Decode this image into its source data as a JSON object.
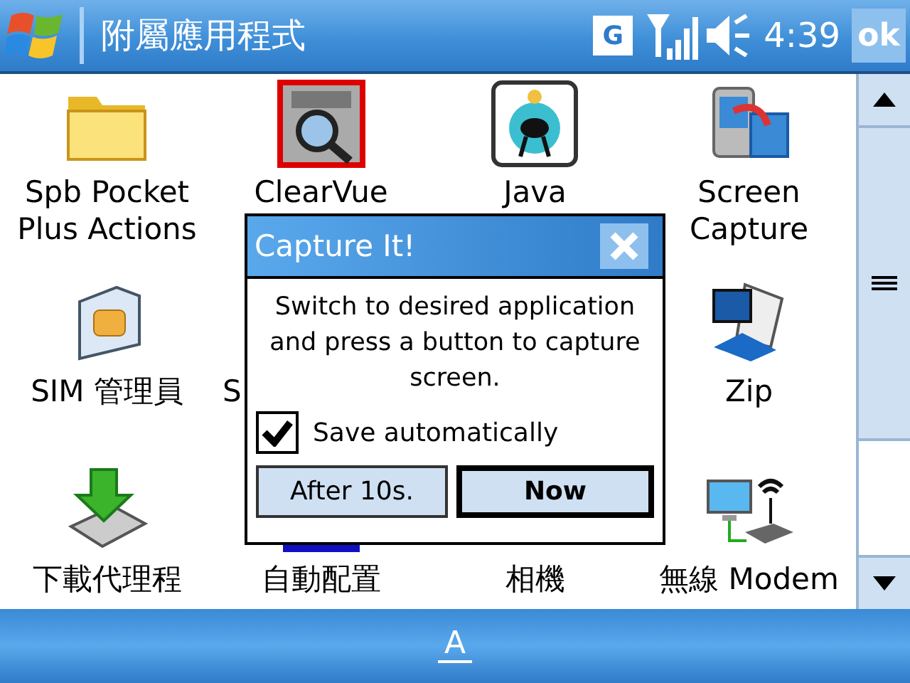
{
  "title_bar": {
    "title": "附屬應用程式",
    "network_badge": "G",
    "time": "4:39",
    "ok": "ok"
  },
  "rows": [
    [
      {
        "label": "Spb Pocket Plus Actions",
        "kind": "folder"
      },
      {
        "label": "ClearVue",
        "kind": "pdf"
      },
      {
        "label": "Java",
        "kind": "java"
      },
      {
        "label": "Screen Capture",
        "kind": "screen"
      }
    ],
    [
      {
        "label": "SIM 管理員",
        "kind": "sim"
      },
      {
        "label": "S",
        "kind": "cut"
      },
      {},
      {
        "label": "Zip",
        "kind": "zip"
      }
    ],
    [
      {
        "label": "下載代理程",
        "kind": "download"
      },
      {
        "label": "自動配置",
        "kind": "config"
      },
      {
        "label": "相機"
      },
      {
        "label": "無線 Modem",
        "kind": "network"
      }
    ]
  ],
  "dialog": {
    "title": "Capture It!",
    "message": "Switch to desired application and press a button to capture screen.",
    "checkbox": {
      "label": "Save automatically",
      "checked": true
    },
    "buttons": [
      {
        "label": "After 10s.",
        "default": false
      },
      {
        "label": "Now",
        "default": true
      }
    ]
  },
  "input_panel": {
    "label": "A"
  }
}
